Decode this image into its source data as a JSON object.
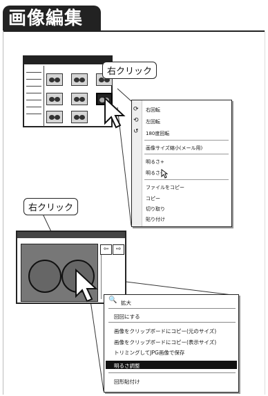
{
  "title": "画像編集",
  "callout_top": "右クリック",
  "callout_bottom": "右クリック",
  "menu1": {
    "items": [
      "右回転",
      "左回転",
      "180度回転",
      "画像サイズ縮小(メール用)",
      "明るさ+",
      "明るさ-",
      "ファイルをコピー",
      "コピー",
      "切り取り",
      "貼り付け"
    ]
  },
  "menu2": {
    "items": [
      "拡大",
      "回回にする",
      "画像をクリップボードにコピー(元のサイズ)",
      "画像をクリップボードにコピー(表示サイズ)",
      "トリミングしてJPG画像で保存",
      "明るさ調整",
      "回形貼付け"
    ]
  },
  "nav": {
    "prev": "⇦",
    "next": "⇨"
  }
}
